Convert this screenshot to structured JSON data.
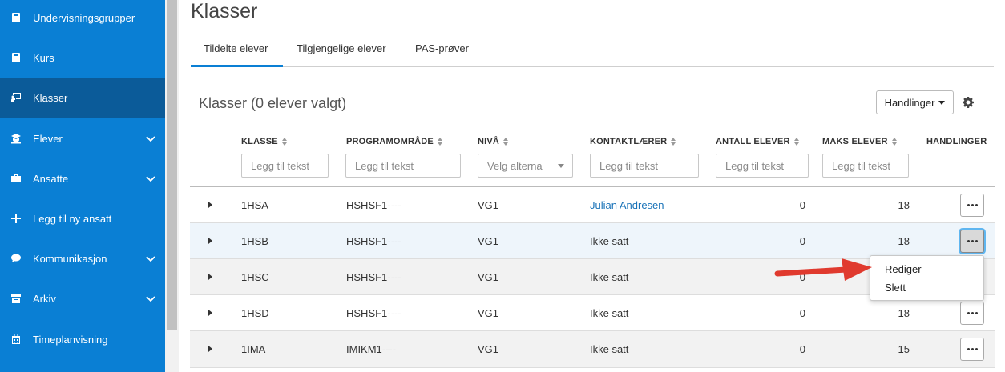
{
  "sidebar": {
    "items": [
      {
        "label": "Undervisningsgrupper",
        "icon": "book-icon",
        "expandable": false
      },
      {
        "label": "Kurs",
        "icon": "book-icon",
        "expandable": false
      },
      {
        "label": "Klasser",
        "icon": "classroom-icon",
        "expandable": false
      },
      {
        "label": "Elever",
        "icon": "student-icon",
        "expandable": true
      },
      {
        "label": "Ansatte",
        "icon": "briefcase-icon",
        "expandable": true
      },
      {
        "label": "Legg til ny ansatt",
        "icon": "plus-icon",
        "expandable": false
      },
      {
        "label": "Kommunikasjon",
        "icon": "chat-bubble-icon",
        "expandable": true
      },
      {
        "label": "Arkiv",
        "icon": "archive-icon",
        "expandable": true
      },
      {
        "label": "Timeplanvisning",
        "icon": "calendar-icon",
        "expandable": false
      }
    ]
  },
  "page": {
    "title": "Klasser"
  },
  "tabs": [
    {
      "label": "Tildelte elever"
    },
    {
      "label": "Tilgjengelige elever"
    },
    {
      "label": "PAS-prøver"
    }
  ],
  "section": {
    "title": "Klasser (0 elever valgt)",
    "actions_button": "Handlinger"
  },
  "table": {
    "columns": [
      "KLASSE",
      "PROGRAMOMRÅDE",
      "NIVÅ",
      "KONTAKTLÆRER",
      "ANTALL ELEVER",
      "MAKS ELEVER",
      "HANDLINGER"
    ],
    "filters": {
      "klasse": "Legg til tekst",
      "programomrade": "Legg til tekst",
      "niva": "Velg alterna",
      "kontaktlaerer": "Legg til tekst",
      "antall": "Legg til tekst",
      "maks": "Legg til tekst"
    },
    "rows": [
      {
        "klasse": "1HSA",
        "programomrade": "HSHSF1----",
        "niva": "VG1",
        "kontaktlaerer": "Julian Andresen",
        "antall": "0",
        "maks": "18"
      },
      {
        "klasse": "1HSB",
        "programomrade": "HSHSF1----",
        "niva": "VG1",
        "kontaktlaerer": "Ikke satt",
        "antall": "0",
        "maks": "18"
      },
      {
        "klasse": "1HSC",
        "programomrade": "HSHSF1----",
        "niva": "VG1",
        "kontaktlaerer": "Ikke satt",
        "antall": "0",
        "maks": ""
      },
      {
        "klasse": "1HSD",
        "programomrade": "HSHSF1----",
        "niva": "VG1",
        "kontaktlaerer": "Ikke satt",
        "antall": "0",
        "maks": "18"
      },
      {
        "klasse": "1IMA",
        "programomrade": "IMIKM1----",
        "niva": "VG1",
        "kontaktlaerer": "Ikke satt",
        "antall": "0",
        "maks": "15"
      }
    ]
  },
  "row_menu": {
    "items": [
      "Rediger",
      "Slett"
    ]
  },
  "colors": {
    "sidebar": "#0a7fd4",
    "sidebar_active": "#0b5b99",
    "link": "#1a73b8",
    "annotation_arrow": "#e03a2e"
  }
}
